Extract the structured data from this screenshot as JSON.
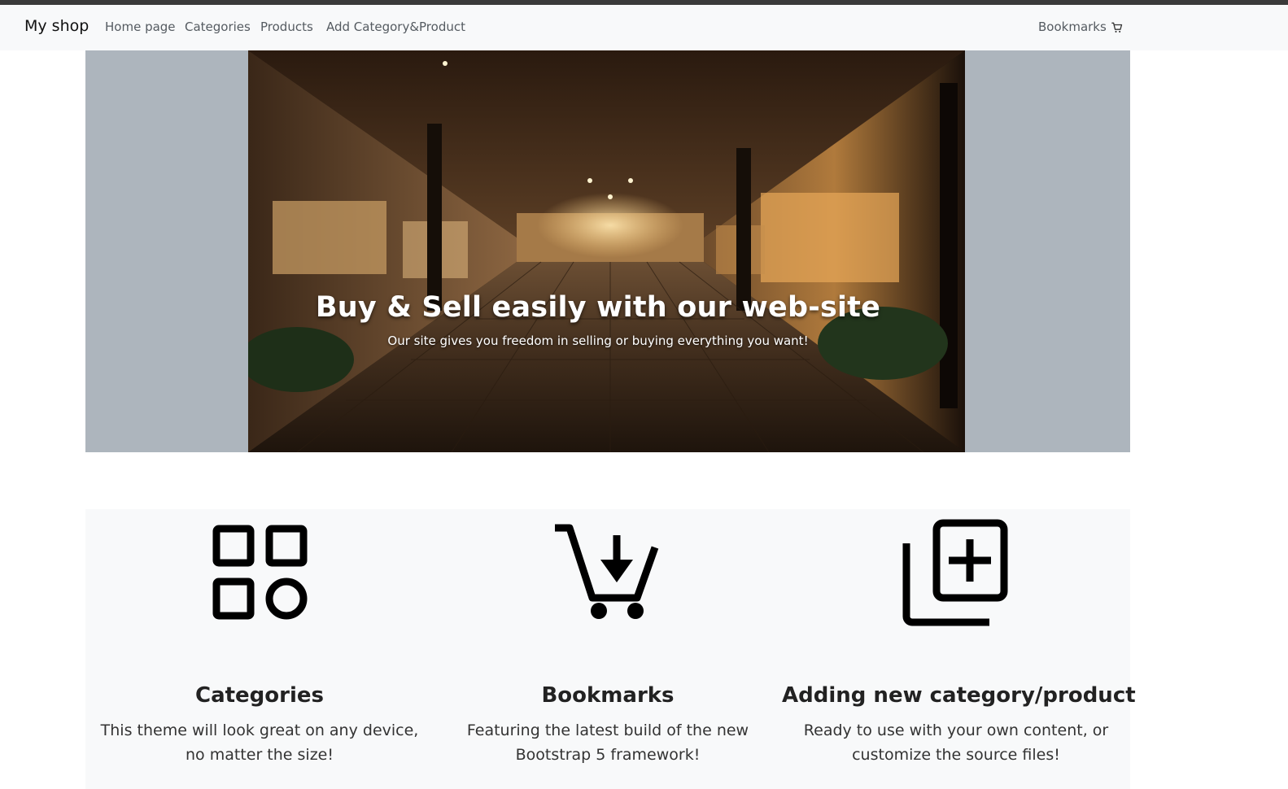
{
  "navbar": {
    "brand": "My shop",
    "links": [
      "Home page",
      "Categories",
      "Products",
      "Add Category&Product"
    ],
    "bookmarks": "Bookmarks",
    "bookmarks_icon": "cart-icon"
  },
  "hero": {
    "title": "Buy & Sell easily with our web-site",
    "subtitle": "Our site gives you freedom in selling or buying everything you want!"
  },
  "features": [
    {
      "icon": "grid-icon",
      "title": "Categories",
      "text": "This theme will look great on any device, no matter the size!"
    },
    {
      "icon": "cart-download-icon",
      "title": "Bookmarks",
      "text": "Featuring the latest build of the new Bootstrap 5 framework!"
    },
    {
      "icon": "add-collection-icon",
      "title": "Adding new category/product",
      "text": "Ready to use with your own content, or customize the source files!"
    }
  ]
}
